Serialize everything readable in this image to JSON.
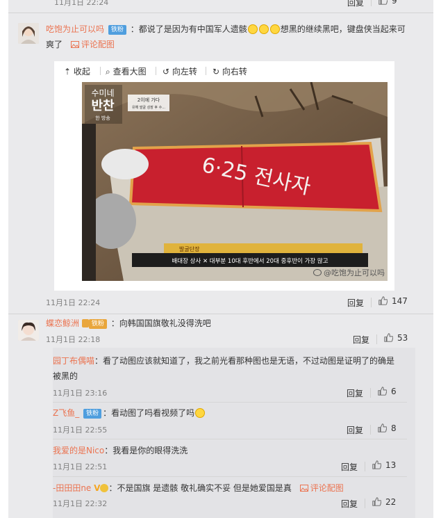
{
  "top_row": {
    "date": "11月1日 22:24",
    "reply": "回复",
    "likes": "9"
  },
  "comment1": {
    "username": "吃饱为止可以吗",
    "badge": "铁粉",
    "text_a": "：都说了是因为有中国军人遗骸",
    "text_b": "想黑的继续黑吧，键盘侠当起来可",
    "text_c": "爽了",
    "pic_link": "评论配图",
    "toolbar": {
      "collapse": "收起",
      "view_large": "查看大图",
      "rotate_left": "向左转",
      "rotate_right": "向右转"
    },
    "video": {
      "logo_line1": "수미네",
      "logo_line2": "반찬",
      "logo_line3": "한 방송",
      "top_caption_line1": "2이에 가다",
      "top_caption_line2": "유해 발굴 성장 후 수...",
      "flag_text": "6·25 전사자",
      "subtitle_label": "발굴단장",
      "subtitle": "배대장 상사 ✕ 대부분 10대 후반에서 20대 중후반이 가장 많고",
      "watermark": "@吃饱为止可以吗"
    },
    "date": "11月1日 22:24",
    "reply": "回复",
    "likes": "147"
  },
  "comment2": {
    "username": "蝶恋鲸洲",
    "badge": "铁粉",
    "text": "：向韩国国旗敬礼没得洗吧",
    "date": "11月1日 22:18",
    "reply": "回复",
    "likes": "53"
  },
  "replies": [
    {
      "username": "园丁布偶喵",
      "badge": "",
      "text": "：看了动图应该就知道了，我之前光看那种图也是无语，不过动图是证明了的确是被黑的",
      "text_line1": "：看了动图应该就知道了，我之前光看那种图也是无语，不过动图是证明了的确是",
      "text_line2": "被黑的",
      "date": "11月1日 23:16",
      "reply": "回复",
      "likes": "6"
    },
    {
      "username": "Z飞鱼_",
      "badge": "铁粉",
      "text": "：看动图了吗看视频了吗",
      "date": "11月1日 22:55",
      "reply": "回复",
      "likes": "8"
    },
    {
      "username": "我爱的是Nico",
      "badge": "",
      "text": "：我看是你的眼得洗洗",
      "date": "11月1日 22:51",
      "reply": "回复",
      "likes": "13"
    },
    {
      "username": "-田田田ne",
      "badge": "",
      "text": "：不是国旗 是遗骸 敬礼确实不妥 但是她爱国是真",
      "pic_link": "评论配图",
      "date": "11月1日 22:32",
      "reply": "回复",
      "likes": "22"
    }
  ],
  "colors": {
    "accent": "#eb7350",
    "badge_blue": "#4f9ede",
    "panel": "#eaeaec",
    "flag_red": "#c8202e"
  }
}
